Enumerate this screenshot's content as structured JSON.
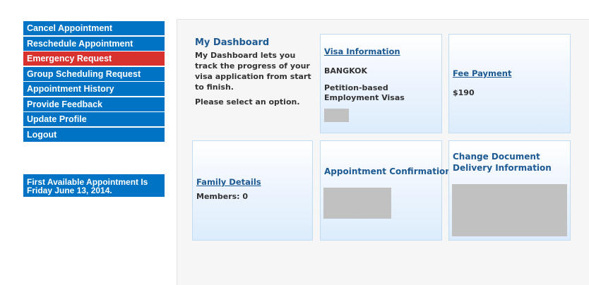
{
  "sidebar": {
    "items": [
      {
        "label": "Cancel Appointment"
      },
      {
        "label": "Reschedule Appointment"
      },
      {
        "label": "Emergency Request"
      },
      {
        "label": "Group Scheduling Request"
      },
      {
        "label": "Appointment History"
      },
      {
        "label": "Provide Feedback"
      },
      {
        "label": "Update Profile"
      },
      {
        "label": "Logout"
      }
    ],
    "first_available": "First Available Appointment Is Friday June 13, 2014."
  },
  "dashboard": {
    "title": "My Dashboard",
    "description": "My Dashboard lets you track the progress of your visa application from start to finish.",
    "instruction": "Please select an option."
  },
  "tiles": {
    "visa_info": {
      "link": "Visa Information",
      "location": "BANGKOK",
      "visa_type": "Petition-based Employment Visas"
    },
    "fee_payment": {
      "link": "Fee Payment",
      "amount": "$190"
    },
    "family_details": {
      "link": "Family Details",
      "members": "Members: 0"
    },
    "appointment_confirmation": {
      "heading": "Appointment Confirmation"
    },
    "document_delivery": {
      "heading": "Change Document Delivery Information"
    }
  },
  "colors": {
    "nav_blue": "#0073c4",
    "emergency_red": "#d8322f",
    "heading_blue": "#1d5a93"
  }
}
